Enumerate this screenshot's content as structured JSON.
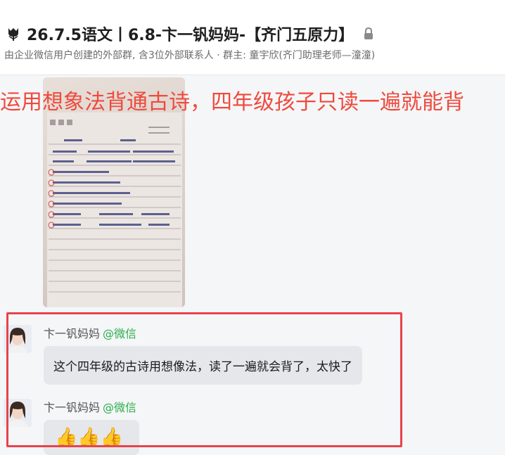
{
  "header": {
    "title": "26.7.5语文丨6.8-卞一钒妈妈-【齐门五原力】",
    "subtitle": "由企业微信用户创建的外部群, 含3位外部联系人 · 群主: 童宇欣(齐门助理老师—潼潼)",
    "title_icon": "tulip-icon",
    "lock_icon": "lock-icon"
  },
  "banner": {
    "text": "运用想象法背通古诗，四年级孩子只读一遍就能背"
  },
  "messages": [
    {
      "sender": "卞一钒妈妈",
      "source": "@微信",
      "text": "这个四年级的古诗用想像法，读了一遍就会背了，太快了"
    },
    {
      "sender": "卞一钒妈妈",
      "source": "@微信",
      "emoji": "👍👍👍"
    }
  ],
  "colors": {
    "accent_red": "#e8434d",
    "wechat_green": "#2bad4a",
    "banner_red": "#ef4a3d"
  }
}
